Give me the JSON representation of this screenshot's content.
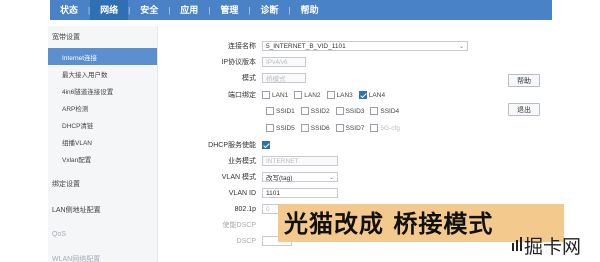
{
  "nav": {
    "items": [
      {
        "label": "状态",
        "active": false
      },
      {
        "label": "网络",
        "active": true
      },
      {
        "label": "安全",
        "active": false
      },
      {
        "label": "应用",
        "active": false
      },
      {
        "label": "管理",
        "active": false
      },
      {
        "label": "诊断",
        "active": false
      },
      {
        "label": "帮助",
        "active": false
      }
    ]
  },
  "sidebar": {
    "group_broadband": "宽带设置",
    "items": [
      {
        "label": "Internet连接",
        "active": true
      },
      {
        "label": "最大接入用户数",
        "active": false
      },
      {
        "label": "4in6隧道连接设置",
        "active": false
      },
      {
        "label": "ARP检测",
        "active": false
      },
      {
        "label": "DHCP清链",
        "active": false
      },
      {
        "label": "组播VLAN",
        "active": false
      },
      {
        "label": "Vxlan配置",
        "active": false
      }
    ],
    "group_bind": "绑定设置",
    "group_lan": "LAN侧地址配置",
    "group_qos": "QoS",
    "group_wlan": "WLAN网络配置"
  },
  "form": {
    "connection_name_label": "连接名称",
    "connection_name_value": "5_INTERNET_B_VID_1101",
    "ip_version_label": "IP协议版本",
    "ip_version_value": "IPv4/v6",
    "mode_label": "模式",
    "mode_value": "桥模式",
    "port_bind_label": "端口绑定",
    "ports": {
      "row1": [
        {
          "label": "LAN1",
          "checked": false
        },
        {
          "label": "LAN2",
          "checked": false
        },
        {
          "label": "LAN3",
          "checked": false
        },
        {
          "label": "LAN4",
          "checked": true
        }
      ],
      "row2": [
        {
          "label": "SSID1",
          "checked": false
        },
        {
          "label": "SSID2",
          "checked": false
        },
        {
          "label": "SSID3",
          "checked": false
        },
        {
          "label": "SSID4",
          "checked": false
        }
      ],
      "row3": [
        {
          "label": "SSID5",
          "checked": false
        },
        {
          "label": "SSID6",
          "checked": false
        },
        {
          "label": "SSID7",
          "checked": false
        },
        {
          "label": "5G-cfg",
          "checked": false
        }
      ]
    },
    "dhcp_label": "DHCP服务使能",
    "dhcp_checked": true,
    "service_mode_label": "业务模式",
    "service_mode_value": "INTERNET",
    "vlan_mode_label": "VLAN 模式",
    "vlan_mode_value": "改写(tag)",
    "vlan_id_label": "VLAN ID",
    "vlan_id_value": "1101",
    "p8021_label": "802.1p",
    "p8021_value": "0",
    "dscp_enable_label": "使能DSCP",
    "dscp_label": "DSCP"
  },
  "buttons": {
    "help": "帮助",
    "exit": "退出"
  },
  "overlay": {
    "banner_text": "光猫改成 桥接模式",
    "watermark_text": "掘卡网"
  },
  "colors": {
    "nav_bg": "#4a82c8",
    "nav_active": "#2f6fb4",
    "sidebar_active": "#5b8fd0",
    "banner_bg": "#f4c98e"
  }
}
